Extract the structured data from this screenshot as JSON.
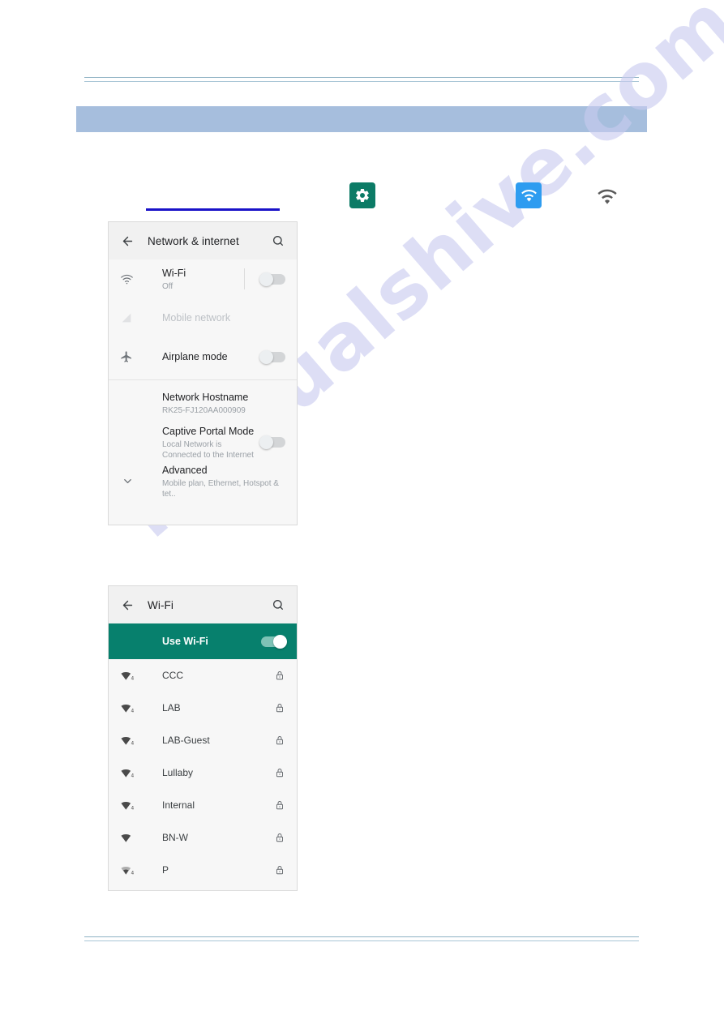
{
  "document": {
    "watermark": "manualshive.com",
    "section_band_label": "",
    "colors": {
      "band": "#a6bedd",
      "rule": "#8fb2c4",
      "teal": "#07806d",
      "blue_icon": "#2e9cf0",
      "gear_icon_bg": "#0c7b66",
      "accent_underline": "#1a12c8"
    }
  },
  "inline_icons": [
    {
      "name": "settings-gear-icon",
      "label": "Settings"
    },
    {
      "name": "wifi-blue-icon",
      "label": "Wi-Fi"
    },
    {
      "name": "wifi-gray-icon",
      "label": "Wi-Fi signal"
    }
  ],
  "screenshot_network": {
    "appbar": {
      "title": "Network & internet",
      "back_icon": "arrow-back-icon",
      "search_icon": "search-icon"
    },
    "rows": [
      {
        "name": "wifi",
        "icon": "wifi-icon",
        "title": "Wi-Fi",
        "subtitle": "Off",
        "toggle": "off",
        "dim": false,
        "divider": true
      },
      {
        "name": "mobile-network",
        "icon": "signal-cellular-icon",
        "title": "Mobile network",
        "subtitle": "",
        "toggle": "none",
        "dim": true,
        "divider": false
      },
      {
        "name": "airplane-mode",
        "icon": "airplane-icon",
        "title": "Airplane mode",
        "subtitle": "",
        "toggle": "off",
        "dim": false,
        "divider": false
      }
    ],
    "rows2": [
      {
        "name": "network-hostname",
        "title": "Network Hostname",
        "subtitle": "RK25-FJ120AA000909",
        "toggle": "none"
      },
      {
        "name": "captive-portal-mode",
        "title": "Captive Portal Mode",
        "subtitle": "Local Network is\nConnected to the Internet",
        "toggle": "off"
      },
      {
        "name": "advanced",
        "title": "Advanced",
        "subtitle": "Mobile plan, Ethernet, Hotspot & tet..",
        "toggle": "none",
        "chevron": "chevron-down-icon"
      }
    ]
  },
  "screenshot_wifi": {
    "appbar": {
      "title": "Wi-Fi",
      "back_icon": "arrow-back-icon",
      "search_icon": "search-icon"
    },
    "use_wifi": {
      "label": "Use Wi-Fi",
      "toggle": "on"
    },
    "networks": [
      {
        "ssid": "CCC",
        "signal": "wifi-4-bars-icon",
        "badge": "4",
        "secured": true
      },
      {
        "ssid": "LAB",
        "signal": "wifi-4-bars-icon",
        "badge": "4",
        "secured": true
      },
      {
        "ssid": "LAB-Guest",
        "signal": "wifi-4-bars-icon",
        "badge": "4",
        "secured": true
      },
      {
        "ssid": "Lullaby",
        "signal": "wifi-4-bars-icon",
        "badge": "4",
        "secured": true
      },
      {
        "ssid": "Internal",
        "signal": "wifi-4-bars-icon",
        "badge": "4",
        "secured": true
      },
      {
        "ssid": "BN-W",
        "signal": "wifi-full-icon",
        "badge": "",
        "secured": true
      },
      {
        "ssid": "P",
        "signal": "wifi-weak-icon",
        "badge": "4",
        "secured": true
      }
    ]
  }
}
